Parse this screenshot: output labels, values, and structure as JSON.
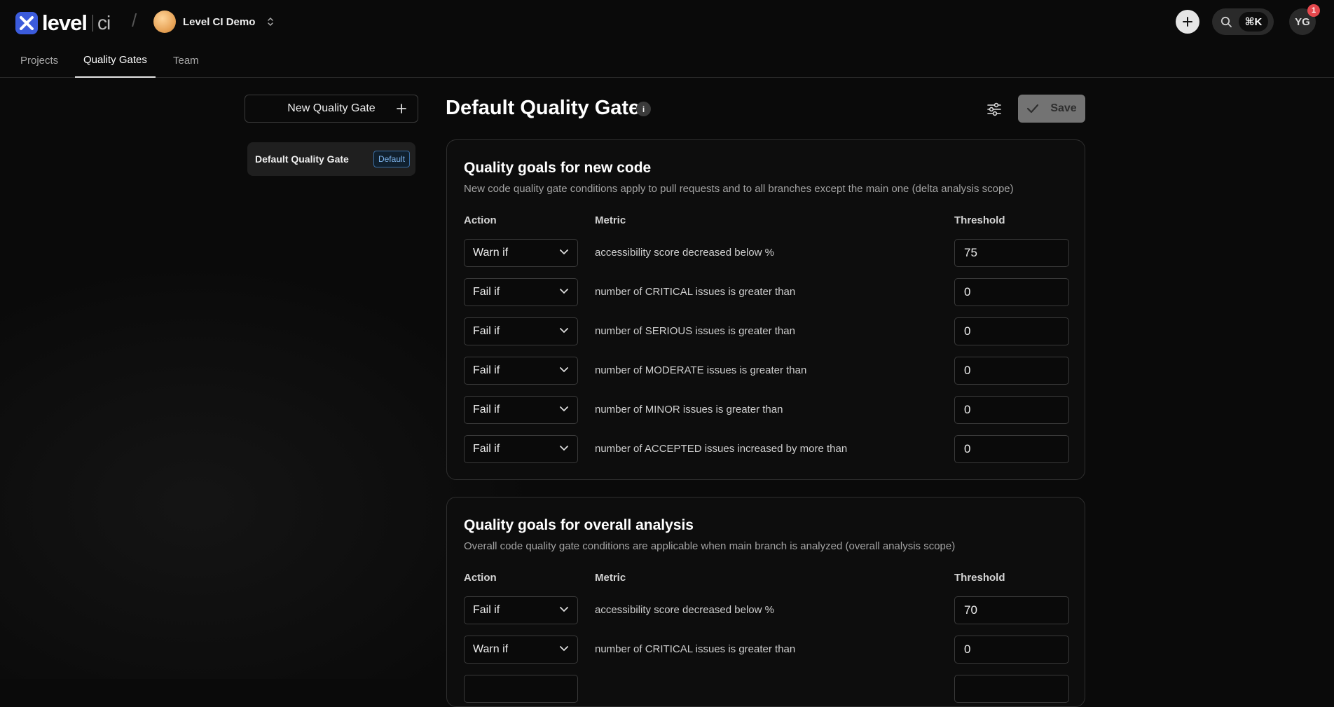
{
  "header": {
    "logo_text": "level",
    "logo_suffix": "ci",
    "project_name": "Level CI Demo",
    "search_shortcut": "⌘K",
    "user_initials": "YG",
    "notification_count": "1"
  },
  "tabs": [
    {
      "label": "Projects",
      "active": false
    },
    {
      "label": "Quality Gates",
      "active": true
    },
    {
      "label": "Team",
      "active": false
    }
  ],
  "sidebar": {
    "new_gate_label": "New Quality Gate",
    "gates": [
      {
        "name": "Default Quality Gate",
        "badge": "Default"
      }
    ]
  },
  "main": {
    "title": "Default Quality Gate",
    "info_glyph": "i",
    "save_label": "Save",
    "sections": [
      {
        "title": "Quality goals for new code",
        "subtitle": "New code quality gate conditions apply to pull requests and to all branches except the main one (delta analysis scope)",
        "col_action": "Action",
        "col_metric": "Metric",
        "col_threshold": "Threshold",
        "rows": [
          {
            "action": "Warn if",
            "metric": "accessibility score decreased below %",
            "threshold": "75"
          },
          {
            "action": "Fail if",
            "metric": "number of CRITICAL issues is greater than",
            "threshold": "0"
          },
          {
            "action": "Fail if",
            "metric": "number of SERIOUS issues is greater than",
            "threshold": "0"
          },
          {
            "action": "Fail if",
            "metric": "number of MODERATE issues is greater than",
            "threshold": "0"
          },
          {
            "action": "Fail if",
            "metric": "number of MINOR issues is greater than",
            "threshold": "0"
          },
          {
            "action": "Fail if",
            "metric": "number of ACCEPTED issues increased by more than",
            "threshold": "0"
          }
        ]
      },
      {
        "title": "Quality goals for overall analysis",
        "subtitle": "Overall code quality gate conditions are applicable when main branch is analyzed (overall analysis scope)",
        "col_action": "Action",
        "col_metric": "Metric",
        "col_threshold": "Threshold",
        "rows": [
          {
            "action": "Fail if",
            "metric": "accessibility score decreased below %",
            "threshold": "70"
          },
          {
            "action": "Warn if",
            "metric": "number of CRITICAL issues is greater than",
            "threshold": "0"
          }
        ]
      }
    ]
  },
  "colors": {
    "background": "#0a0a0a",
    "brand": "#3b5bdb",
    "badge_blue": "#7db3ea",
    "notification": "#e5484d",
    "save_disabled": "#737373"
  }
}
